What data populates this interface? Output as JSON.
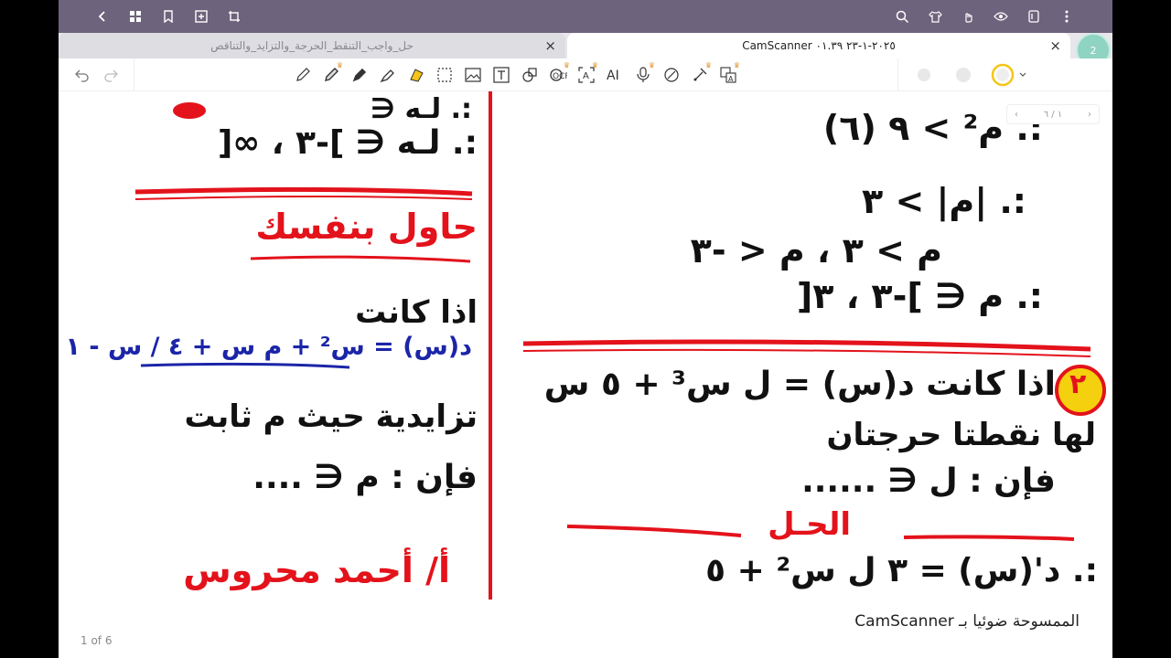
{
  "topbar": {
    "icons": [
      "back-icon",
      "grid-icon",
      "bookmark-icon",
      "add-page-icon",
      "crop-icon",
      "search-icon",
      "shirt-icon",
      "hand-icon",
      "eye-icon",
      "document-icon",
      "more-icon"
    ]
  },
  "tabs": [
    {
      "label": "حل_واجب_التنقط_الحرجة_والتزايد_والتناقص"
    },
    {
      "label": "CamScanner ٢٠٢٥-١-٢٣ ٠١.٣٩"
    }
  ],
  "avatar": {
    "label": "2"
  },
  "page": {
    "left": {
      "line1": ":. لـه ∈ ]-٣ ، ∞[",
      "try": "حاول بنفسك",
      "q1": "اذا كانت",
      "func": "د(س) = س² + م س + ٤ / س - ١",
      "q2": "تزايدية حيث م ثابت",
      "q3": "فإن : م ∈ ....",
      "author": "أ/ أحمد محروس"
    },
    "right": {
      "r1": ":. م² > ٩ (٦)",
      "r2": ":. |م| > ٣",
      "r3": "م > ٣ ، م < -٣",
      "r4": ":. م ∈ ]-٣ ، ٣[",
      "num": "٢",
      "p1": "اذا كانت د(س) = ل س³ + ٥ س",
      "p2": "لها نقطتا حرجتان",
      "p3": "فإن : ل ∈ ......",
      "sol": "الحـل",
      "s1": ":. د'(س) = ٣ ل س² + ٥"
    }
  },
  "footer": {
    "page_count": "1 of 6",
    "watermark": "الممسوحة ضوئيا بـ CamScanner",
    "pager": "١ / ٦"
  },
  "colors": {
    "topbar": "#6e637c",
    "ink_red": "#e3121b",
    "ink_blue": "#1b25a8"
  }
}
